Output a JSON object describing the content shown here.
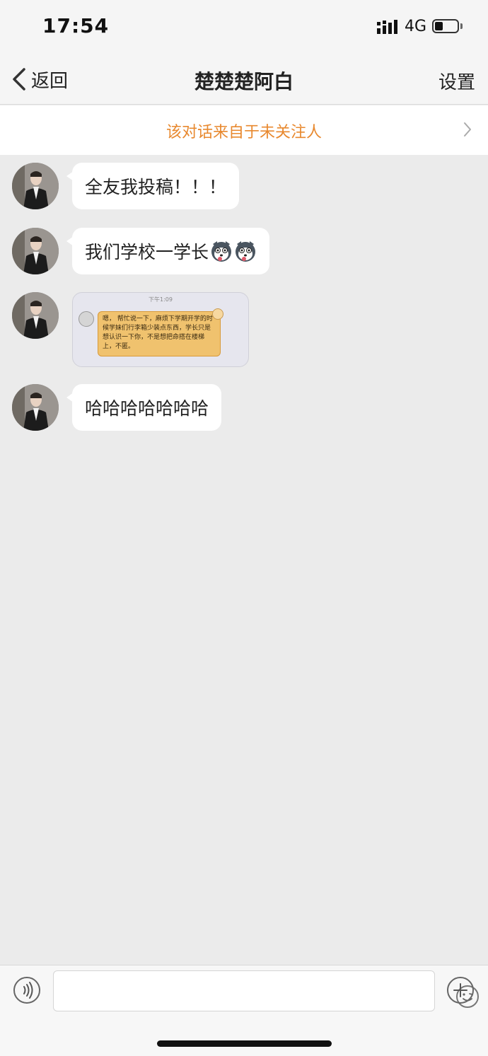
{
  "status_bar": {
    "time": "17:54",
    "network": "4G"
  },
  "nav": {
    "back_label": "返回",
    "title": "楚楚楚阿白",
    "settings_label": "设置"
  },
  "notice": {
    "text": "该对话来自于未关注人"
  },
  "messages": [
    {
      "type": "text",
      "text": "全友我投稿！！！"
    },
    {
      "type": "text",
      "text": "我们学校一学长",
      "emojis": [
        "husky-emoji",
        "husky-emoji"
      ]
    },
    {
      "type": "image",
      "time": "下午1:09",
      "text": "嗯，  帮忙说一下，麻烦下学期开学的时候学妹们行李箱少装点东西，学长只是想认识一下你，不是想把命搭在楼梯上，不匿。"
    },
    {
      "type": "text",
      "text": "哈哈哈哈哈哈哈"
    }
  ],
  "colors": {
    "notice_text": "#e8892f",
    "chat_bg": "#ebebeb",
    "bubble_bg": "#ffffff"
  }
}
